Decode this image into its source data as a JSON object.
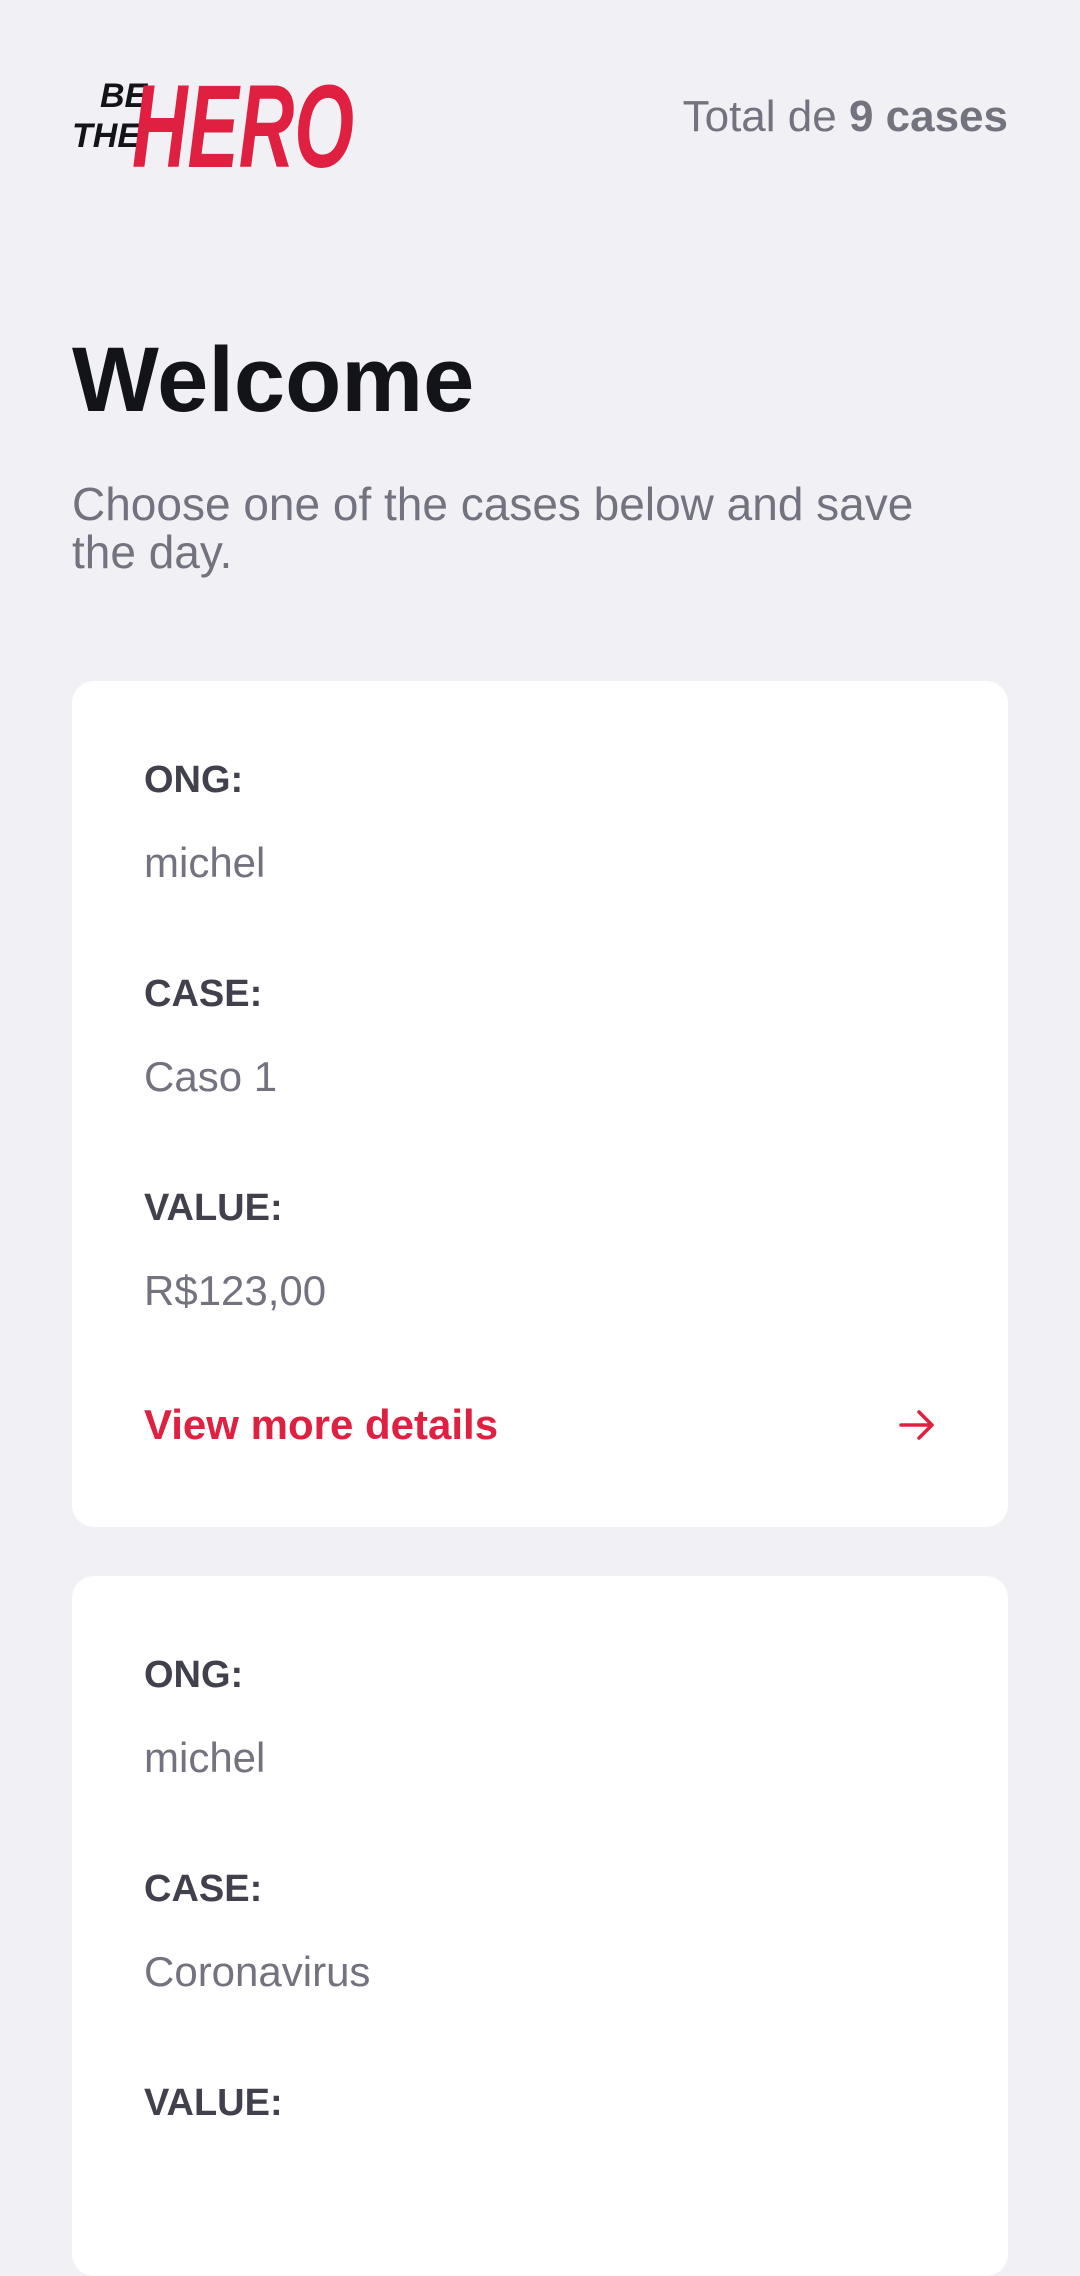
{
  "colors": {
    "background": "#f0f0f5",
    "accent": "#e02041",
    "heading": "#13131a",
    "label": "#41414d",
    "muted": "#737380",
    "card": "#ffffff"
  },
  "header": {
    "logo": {
      "line1": "BE",
      "line2": "THE",
      "word": "HERO"
    },
    "total_prefix": "Total de",
    "total_count": "9 cases"
  },
  "main": {
    "title": "Welcome",
    "subtitle": "Choose one of the cases below and save the day."
  },
  "labels": {
    "ong": "ONG:",
    "case": "CASE:",
    "value": "VALUE:",
    "details": "View more details"
  },
  "incidents": [
    {
      "ong": "michel",
      "case": "Caso 1",
      "value": "R$123,00",
      "icon": "arrow-right-icon"
    },
    {
      "ong": "michel",
      "case": "Coronavirus"
    }
  ]
}
